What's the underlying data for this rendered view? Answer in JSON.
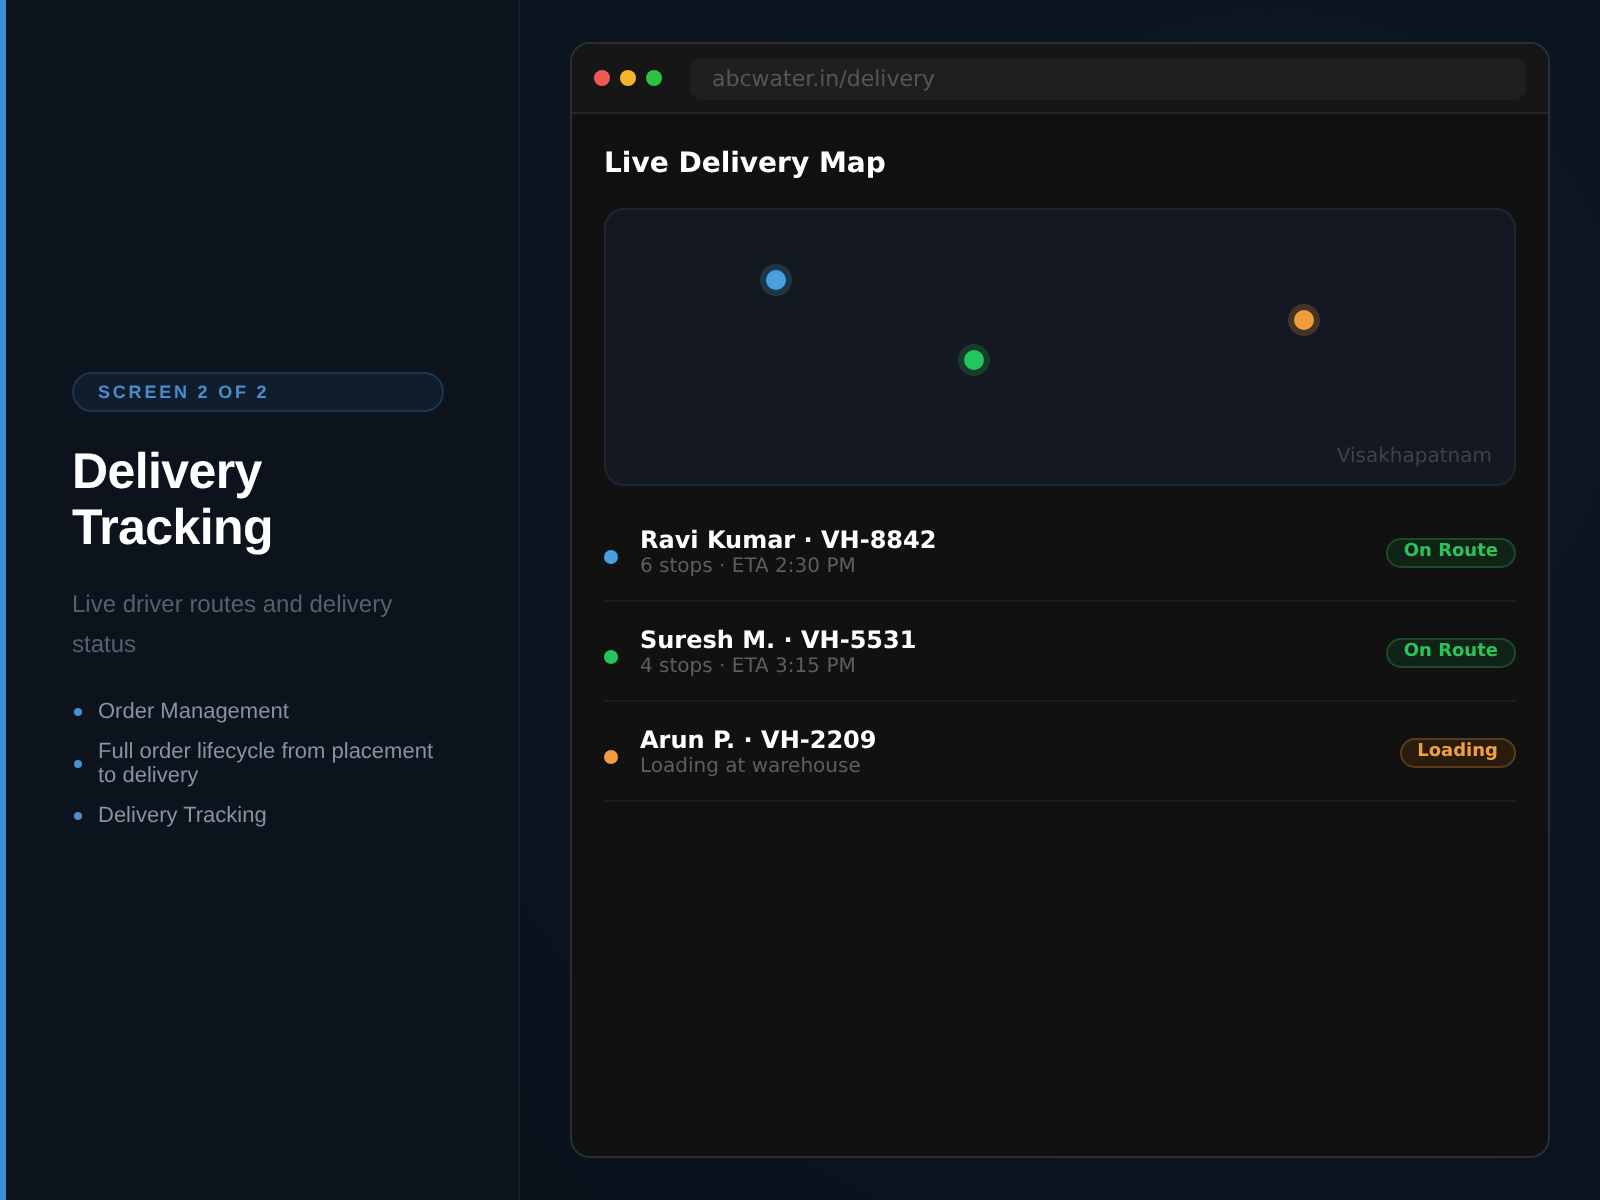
{
  "intro": {
    "badge": "SCREEN 2 OF 2",
    "title": "Delivery Tracking",
    "subtitle": "Live driver routes and delivery status",
    "features": [
      "Order Management",
      "Full order lifecycle from placement to delivery",
      "Delivery Tracking"
    ]
  },
  "browser": {
    "url": "abcwater.in/delivery"
  },
  "map": {
    "title": "Live Delivery Map",
    "location": "Visakhapatnam",
    "pins": [
      {
        "color": "#4a9fe0"
      },
      {
        "color": "#22c55e"
      },
      {
        "color": "#f39c3d"
      }
    ]
  },
  "drivers": [
    {
      "name": "Ravi Kumar · VH-8842",
      "detail": "6 stops · ETA 2:30 PM",
      "color": "#4a9fe0",
      "status": {
        "label": "On Route",
        "kind": "on_route"
      }
    },
    {
      "name": "Suresh M. · VH-5531",
      "detail": "4 stops · ETA 3:15 PM",
      "color": "#22c55e",
      "status": {
        "label": "On Route",
        "kind": "on_route"
      }
    },
    {
      "name": "Arun P. · VH-2209",
      "detail": "Loading at warehouse",
      "color": "#f39c3d",
      "status": {
        "label": "Loading",
        "kind": "loading"
      }
    }
  ]
}
